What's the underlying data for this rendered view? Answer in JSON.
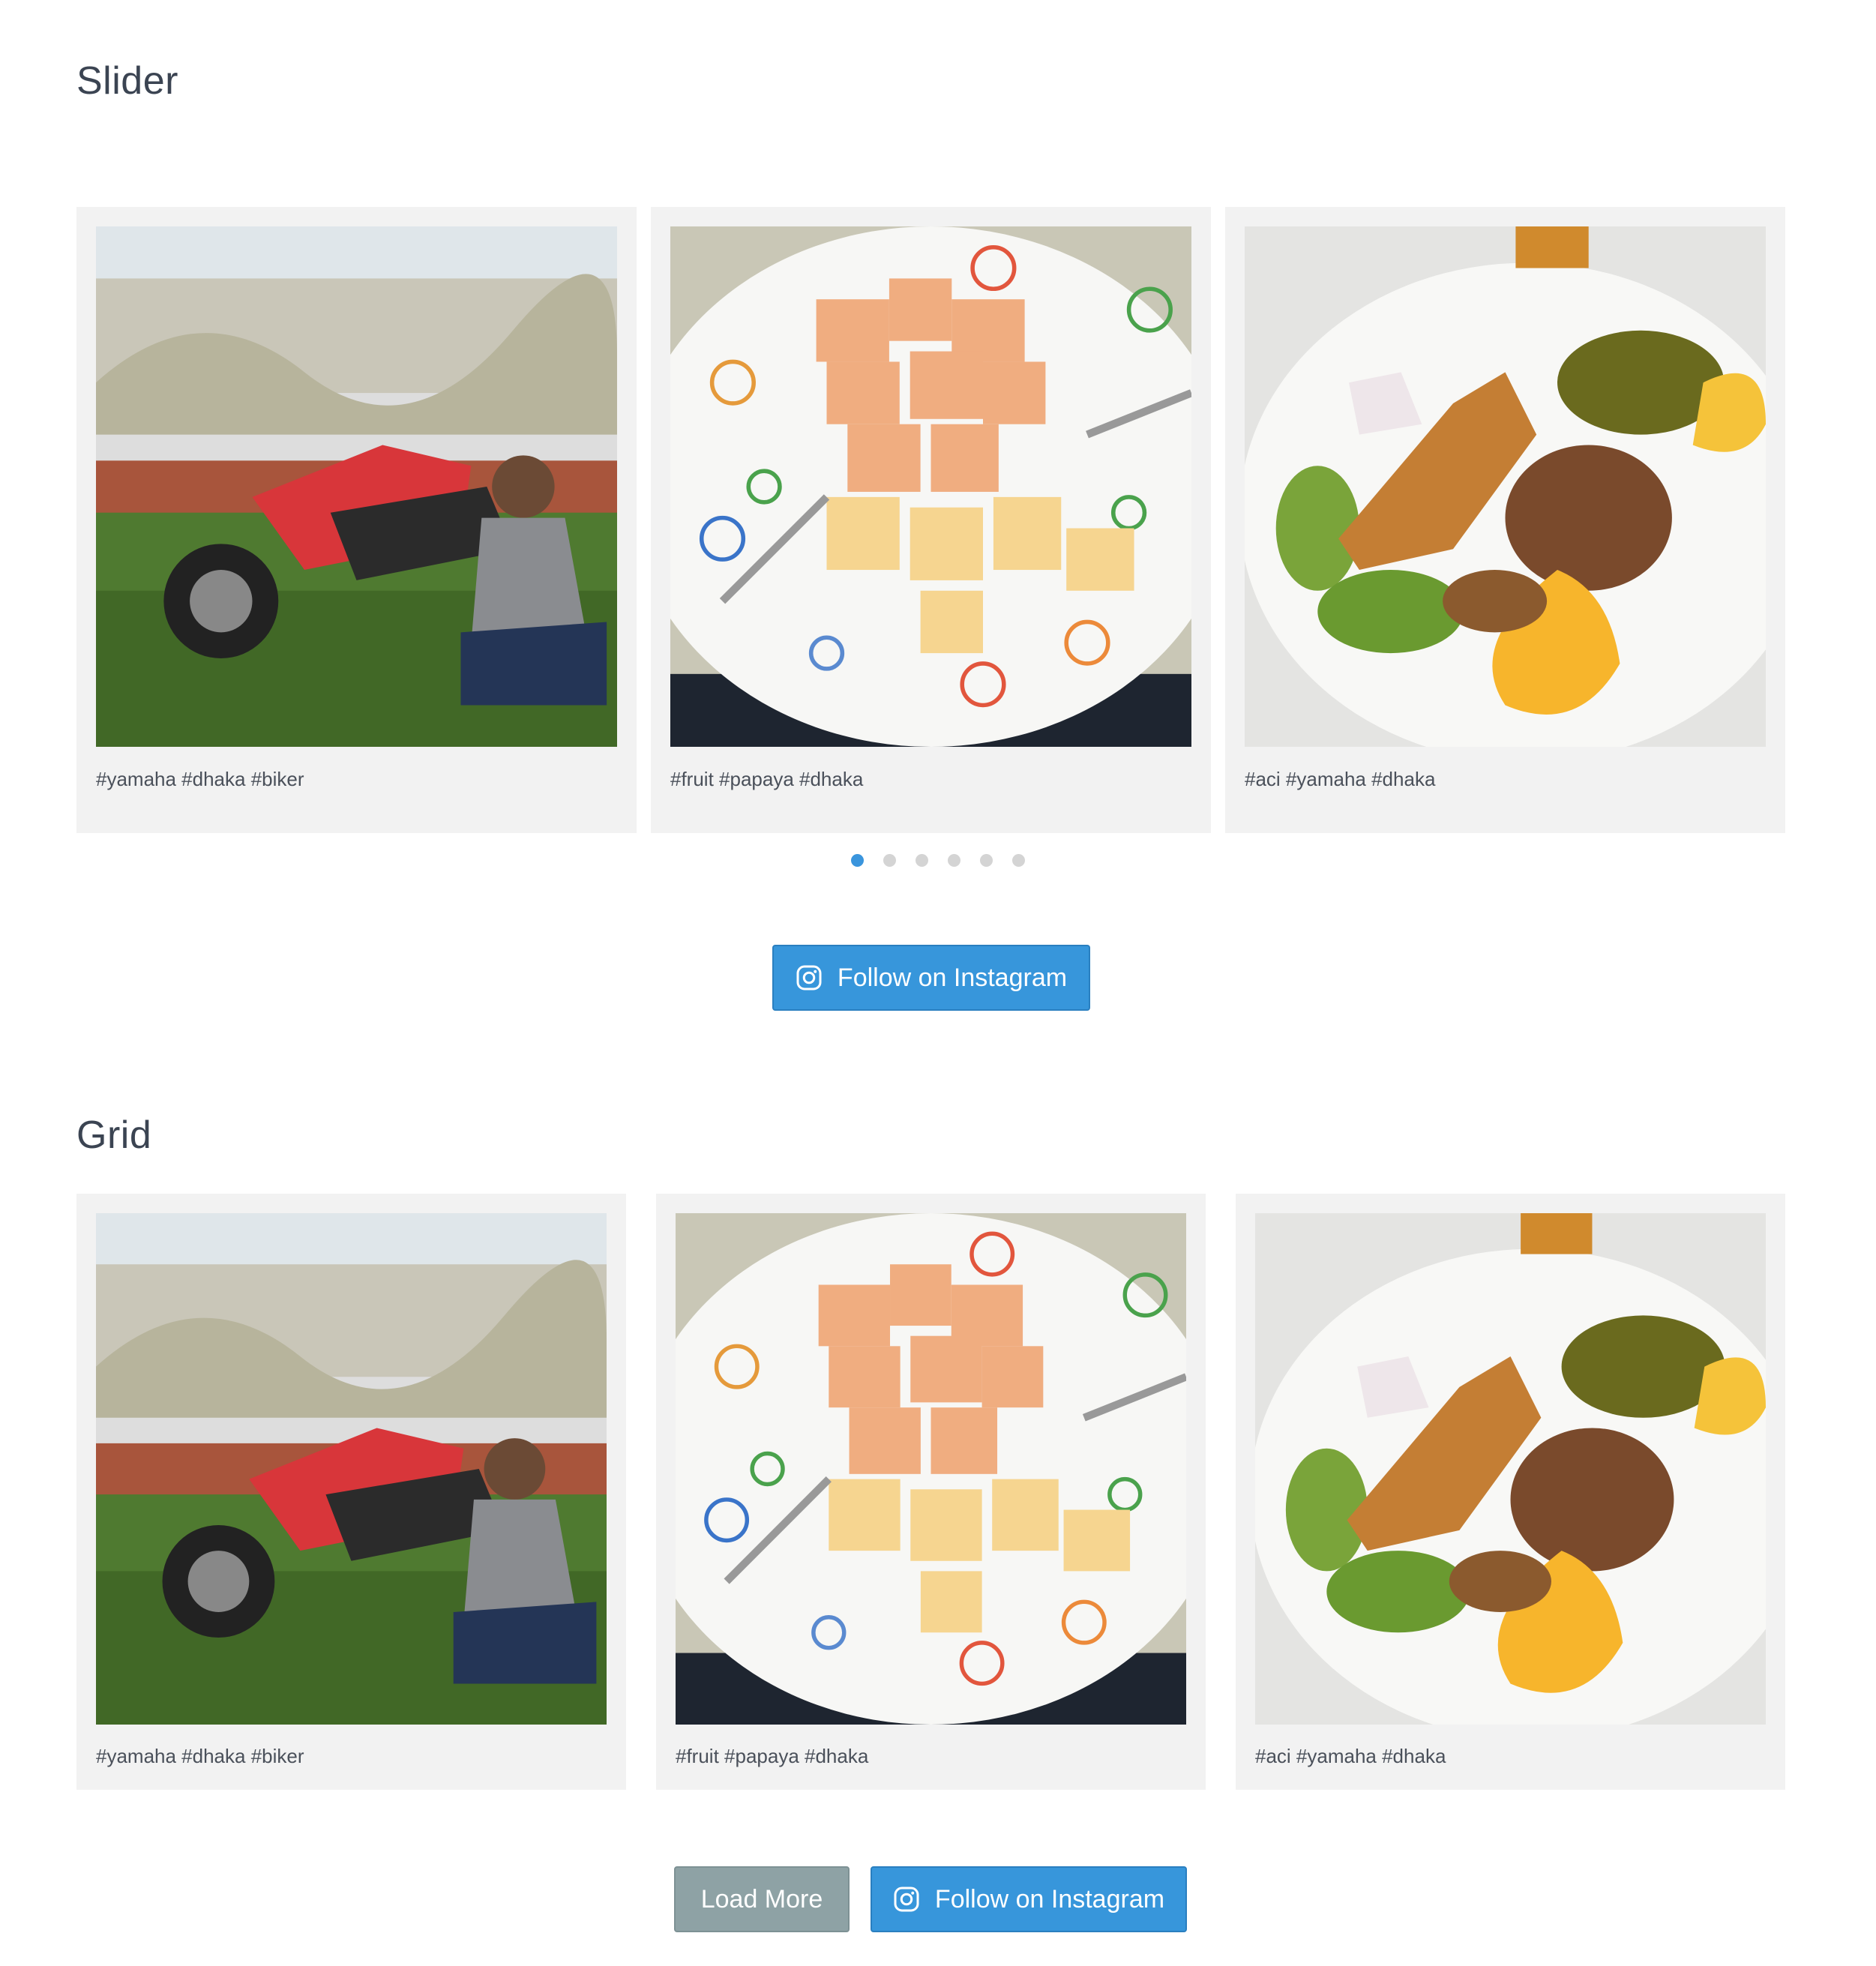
{
  "slider": {
    "title": "Slider",
    "posts": [
      {
        "caption": "#yamaha #dhaka #biker",
        "image": "motorbike-man-photo"
      },
      {
        "caption": "#fruit #papaya #dhaka",
        "image": "papaya-plate-photo"
      },
      {
        "caption": "#aci #yamaha #dhaka",
        "image": "food-plate-photo"
      }
    ],
    "dots": 6,
    "active_dot": 0,
    "follow_label": "Follow on Instagram"
  },
  "grid": {
    "title": "Grid",
    "posts": [
      {
        "caption": "#yamaha #dhaka #biker",
        "image": "motorbike-man-photo"
      },
      {
        "caption": "#fruit #papaya #dhaka",
        "image": "papaya-plate-photo"
      },
      {
        "caption": "#aci #yamaha #dhaka",
        "image": "food-plate-photo"
      }
    ],
    "load_more_label": "Load More",
    "follow_label": "Follow on Instagram"
  },
  "colors": {
    "accent": "#3796db",
    "load_more": "#8ea2a5",
    "card_bg": "#f2f2f2",
    "active_dot": "#3a95dd",
    "inactive_dot": "#d4d4d4"
  }
}
